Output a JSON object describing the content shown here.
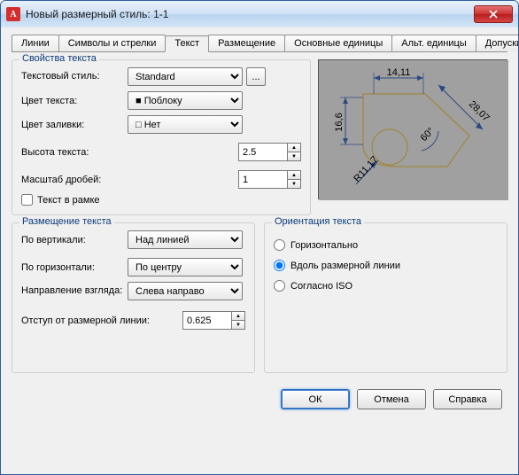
{
  "window": {
    "title": "Новый размерный стиль: 1-1"
  },
  "tabs": [
    "Линии",
    "Символы и стрелки",
    "Текст",
    "Размещение",
    "Основные единицы",
    "Альт. единицы",
    "Допуски"
  ],
  "active_tab_index": 2,
  "text_props": {
    "legend": "Свойства текста",
    "style_label": "Текстовый стиль:",
    "style_value": "Standard",
    "color_label": "Цвет текста:",
    "color_value": "Поблоку",
    "color_swatch": "#000000",
    "fill_label": "Цвет заливки:",
    "fill_value": "Нет",
    "height_label": "Высота текста:",
    "height_value": "2.5",
    "scale_label": "Масштаб дробей:",
    "scale_value": "1",
    "frame_label": "Текст в рамке",
    "frame_checked": false
  },
  "placement": {
    "legend": "Размещение текста",
    "vert_label": "По вертикали:",
    "vert_value": "Над линией",
    "horz_label": "По горизонтали:",
    "horz_value": "По центру",
    "view_label": "Направление взгляда:",
    "view_value": "Слева направо",
    "offset_label": "Отступ от размерной линии:",
    "offset_value": "0.625"
  },
  "orientation": {
    "legend": "Ориентация текста",
    "opts": [
      "Горизонтально",
      "Вдоль размерной линии",
      "Согласно ISO"
    ],
    "selected_index": 1
  },
  "preview_dims": {
    "top": "14,11",
    "left": "16,6",
    "right": "28,07",
    "angle": "60°",
    "radius": "R11,17"
  },
  "buttons": {
    "ok": "ОК",
    "cancel": "Отмена",
    "help": "Справка"
  },
  "ellipsis": "..."
}
